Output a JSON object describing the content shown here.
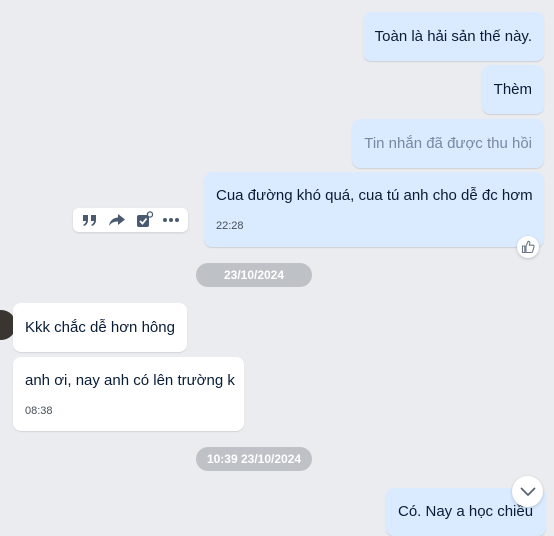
{
  "messages": {
    "out1": {
      "text": "Toàn là hải sản thế này."
    },
    "out2": {
      "text": "Thèm"
    },
    "out3": {
      "text": "Tin nhắn đã được thu hồi"
    },
    "out4": {
      "text": "Cua đường khó quá, cua tú anh cho dễ đc hơm",
      "time": "22:28"
    },
    "in1": {
      "text": "Kkk chắc dễ hơn hông"
    },
    "in2": {
      "text": "anh ơi, nay anh có lên trường k",
      "time": "08:38"
    },
    "out5": {
      "text": "Có. Nay a học chiều"
    }
  },
  "separators": {
    "date1": "23/10/2024",
    "date2": "10:39 23/10/2024"
  },
  "icons": {
    "quote": "quote-icon",
    "forward": "forward-icon",
    "task": "task-icon",
    "more": "more-icon",
    "like": "like-icon",
    "scroll": "chevron-down-icon"
  },
  "colors": {
    "background": "#ebecf0",
    "outgoing_bubble": "#dbebff",
    "incoming_bubble": "#ffffff",
    "date_pill": "#bec1c6",
    "recalled_text": "#7589a3",
    "text": "#081c36"
  }
}
